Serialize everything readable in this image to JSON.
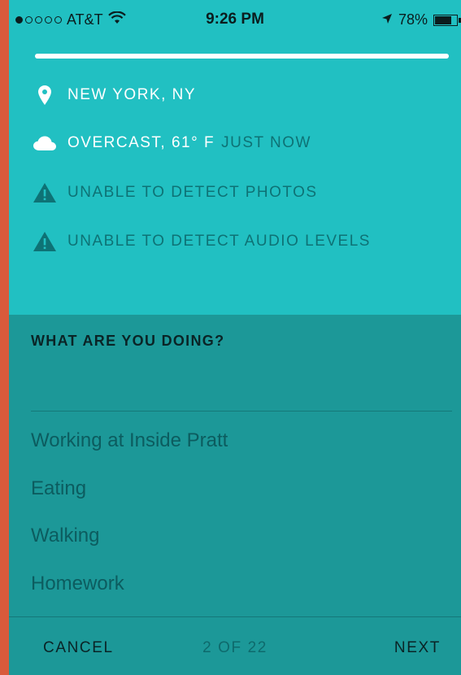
{
  "status_bar": {
    "carrier": "AT&T",
    "signal_bars_filled": 1,
    "signal_bars_total": 5,
    "time": "9:26 PM",
    "battery": "78%",
    "battery_level": 0.78,
    "icons": [
      "signal-dots-icon",
      "wifi-icon",
      "location-arrow-icon",
      "battery-icon"
    ]
  },
  "progress": {
    "value": 1.0
  },
  "info": {
    "location": "NEW YORK, NY",
    "weather": "OVERCAST, 61° F",
    "weather_time": "JUST NOW",
    "photos": "UNABLE TO DETECT PHOTOS",
    "audio": "UNABLE TO DETECT AUDIO LEVELS"
  },
  "doing": {
    "question": "WHAT ARE YOU DOING?",
    "input_value": "",
    "suggestions": [
      "Working at Inside Pratt",
      "Eating",
      "Walking",
      "Homework"
    ]
  },
  "footer": {
    "cancel": "CANCEL",
    "pager": "2 OF 22",
    "next": "NEXT"
  },
  "colors": {
    "frame": "#d95a3b",
    "top_panel": "#21c0c2",
    "bottom_panel": "#1c9898",
    "muted_text": "#0e7275"
  }
}
